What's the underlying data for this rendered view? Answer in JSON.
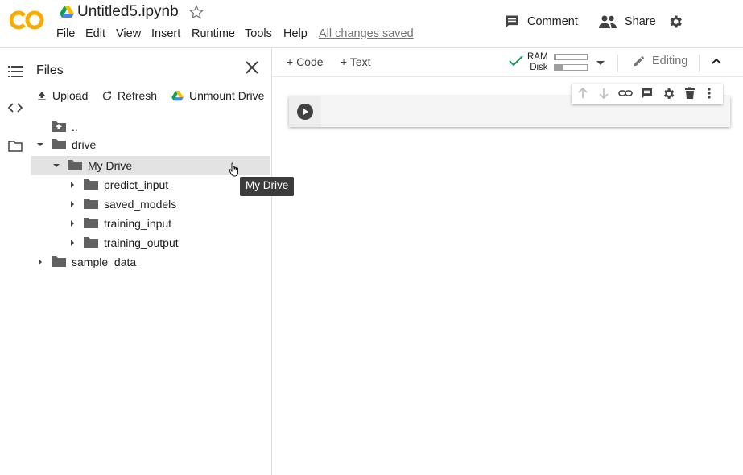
{
  "header": {
    "logo_text": "CO",
    "notebook_title": "Untitled5.ipynb",
    "menu": [
      "File",
      "Edit",
      "View",
      "Insert",
      "Runtime",
      "Tools",
      "Help"
    ],
    "save_status": "All changes saved",
    "comment_label": "Comment",
    "share_label": "Share"
  },
  "files_panel": {
    "title": "Files",
    "actions": {
      "upload": "Upload",
      "refresh": "Refresh",
      "unmount": "Unmount Drive"
    },
    "tree": {
      "parent": "..",
      "drive": "drive",
      "my_drive": "My Drive",
      "predict_input": "predict_input",
      "saved_models": "saved_models",
      "training_input": "training_input",
      "training_output": "training_output",
      "sample_data": "sample_data"
    },
    "tooltip": "My Drive"
  },
  "toolbar": {
    "add_code": "+ Code",
    "add_text": "+ Text",
    "ram_label": "RAM",
    "disk_label": "Disk",
    "ram_fill": 0.04,
    "disk_fill": 0.28,
    "editing_label": "Editing"
  },
  "colors": {
    "logo_orange": "#f9ab00",
    "check_green": "#0f9d58",
    "tooltip_bg": "#3c3c3c"
  }
}
